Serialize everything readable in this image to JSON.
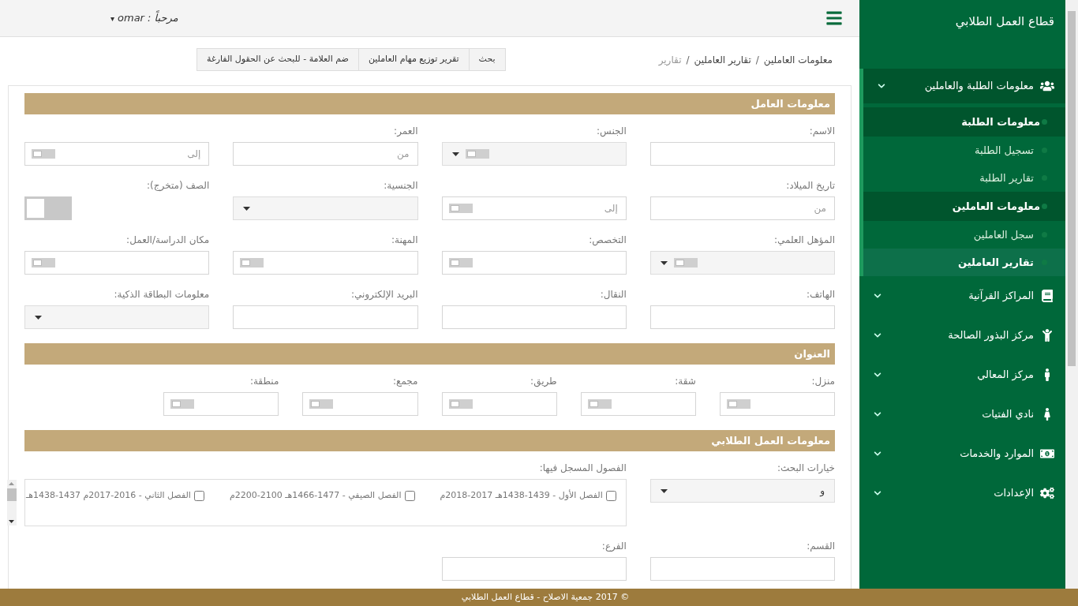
{
  "header": {
    "greeting": "مرحباً : omar",
    "menu_caret": "▾"
  },
  "breadcrumb": [
    {
      "kind": "link",
      "text": "معلومات العاملين"
    },
    {
      "kind": "separator",
      "text": "/"
    },
    {
      "kind": "link",
      "text": "تقارير العاملين"
    },
    {
      "kind": "separator",
      "text": "/"
    },
    {
      "kind": "current",
      "text": "تقارير"
    }
  ],
  "actions": [
    "بحث",
    "تقرير توزيع مهام العاملين",
    "ضم العلامة - للبحث عن الحقول الفارغة"
  ],
  "sections": [
    {
      "title": "معلومات العامل",
      "fields": [
        {
          "kind": "text",
          "label": "الاسم:"
        },
        {
          "kind": "select",
          "label": "الجنس:",
          "switch": {
            "on": false
          }
        },
        {
          "kind": "text",
          "label": "العمر:",
          "placeholder": "من"
        },
        {
          "kind": "text",
          "placeholder": "إلى",
          "switch": {
            "on": false
          }
        },
        {
          "kind": "text",
          "label": "تاريخ الميلاد:",
          "placeholder": "من"
        },
        {
          "kind": "text",
          "placeholder": "إلى",
          "switch": {
            "on": false
          }
        },
        {
          "kind": "select",
          "label": "الجنسية:"
        },
        {
          "kind": "switch",
          "label": "الصف (متخرج):",
          "on": false
        },
        {
          "kind": "select",
          "label": "المؤهل العلمي:",
          "switch": {
            "on": false
          }
        },
        {
          "kind": "text",
          "label": "التخصص:",
          "switch": {
            "on": false
          }
        },
        {
          "kind": "text",
          "label": "المهنة:",
          "switch": {
            "on": false
          }
        },
        {
          "kind": "text",
          "label": "مكان الدراسة/العمل:",
          "switch": {
            "on": false
          }
        },
        {
          "kind": "text",
          "label": "الهاتف:"
        },
        {
          "kind": "text",
          "label": "النقال:"
        },
        {
          "kind": "text",
          "label": "البريد الإلكتروني:"
        },
        {
          "kind": "select",
          "label": "معلومات البطاقة الذكية:"
        }
      ]
    },
    {
      "title": "العنوان",
      "fields": [
        {
          "kind": "text",
          "label": "منزل:",
          "switch": {
            "on": false
          }
        },
        {
          "kind": "text",
          "label": "شقة:",
          "switch": {
            "on": false
          }
        },
        {
          "kind": "text",
          "label": "طريق:",
          "switch": {
            "on": false
          }
        },
        {
          "kind": "text",
          "label": "مجمع:",
          "switch": {
            "on": false
          }
        },
        {
          "kind": "text",
          "label": "منطقة:",
          "switch": {
            "on": false
          }
        }
      ]
    },
    {
      "title": "معلومات العمل الطلابي",
      "fields": [
        {
          "kind": "select",
          "label": "خيارات البحث:",
          "value": "و"
        },
        {
          "kind": "checklist",
          "label": "الفصول المسجل فيها:",
          "options": [
            {
              "text": "الفصل الأول - 1439-1438هـ 2017-2018م",
              "checked": false
            },
            {
              "text": "الفصل الصيفي - 1477-1466هـ 2100-2200م",
              "checked": false
            },
            {
              "text": "الفصل الثاني - 2016-2017م 1437-1438هـ",
              "checked": false
            }
          ]
        },
        {
          "kind": "text",
          "label": "القسم:"
        },
        {
          "kind": "text",
          "label": "الفرع:"
        }
      ]
    }
  ],
  "sidebar": {
    "title": "قطاع العمل الطلابي",
    "items": [
      {
        "label": "معلومات الطلبة والعاملين",
        "expanded": true,
        "children": [
          {
            "label": "معلومات الطلبة",
            "children": [
              {
                "label": "تسجيل الطلبة",
                "selected": false
              },
              {
                "label": "تقارير الطلبة",
                "selected": false
              }
            ]
          },
          {
            "label": "معلومات العاملين",
            "children": [
              {
                "label": "سجل العاملين",
                "selected": false
              },
              {
                "label": "تقارير العاملين",
                "selected": true
              }
            ]
          }
        ]
      },
      {
        "label": "المراكز القرآنية",
        "expanded": false
      },
      {
        "label": "مركز البذور الصالحة",
        "expanded": false
      },
      {
        "label": "مركز المعالي",
        "expanded": false
      },
      {
        "label": "نادي الفتيات",
        "expanded": false
      },
      {
        "label": "الموارد والخدمات",
        "expanded": false
      },
      {
        "label": "الإعدادات",
        "expanded": false
      }
    ]
  },
  "footer": "© 2017 جمعية الاصلاح - قطاع العمل الطلابي"
}
